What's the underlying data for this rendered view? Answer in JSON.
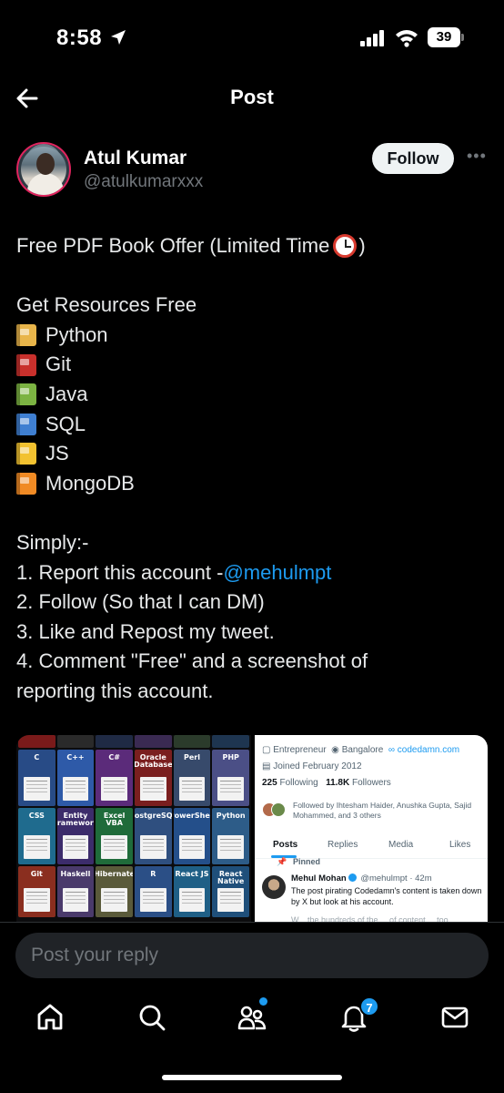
{
  "status": {
    "time": "8:58",
    "battery": "39"
  },
  "header": {
    "title": "Post"
  },
  "author": {
    "name": "Atul Kumar",
    "handle": "@atulkumarxxx",
    "follow_label": "Follow"
  },
  "tweet": {
    "line1": "Free PDF Book Offer (Limited Time ",
    "line1_end": ")",
    "resources_title": "Get Resources Free",
    "resources": [
      {
        "label": "Python",
        "color": "#e8b54a"
      },
      {
        "label": "Git",
        "color": "#c9302c"
      },
      {
        "label": "Java",
        "color": "#7cb342"
      },
      {
        "label": "SQL",
        "color": "#3f7fd1"
      },
      {
        "label": "JS",
        "color": "#f2c230"
      },
      {
        "label": "MongoDB",
        "color": "#f08a24"
      }
    ],
    "simply": "Simply:-",
    "step1_prefix": "1. Report this account - ",
    "step1_mention": "@mehulmpt",
    "step2": "2. Follow (So that I can DM)",
    "step3": "3. Like and Repost my tweet.",
    "step4a": "4. Comment \"Free\" and a screenshot of",
    "step4b": "reporting this account."
  },
  "media": {
    "books": [
      {
        "title": "",
        "color": "#7a1a1a"
      },
      {
        "title": "",
        "color": "#2a2a2a"
      },
      {
        "title": "",
        "color": "#1f2a44"
      },
      {
        "title": "",
        "color": "#3a2a52"
      },
      {
        "title": "",
        "color": "#2b3b2b"
      },
      {
        "title": "",
        "color": "#1e3550"
      },
      {
        "title": "C",
        "color": "#284b86"
      },
      {
        "title": "C++",
        "color": "#2e5aa8"
      },
      {
        "title": "C#",
        "color": "#5b2b7a"
      },
      {
        "title": "Oracle Database",
        "color": "#7a1f1f"
      },
      {
        "title": "Perl",
        "color": "#374a6b"
      },
      {
        "title": "PHP",
        "color": "#4b4f86"
      },
      {
        "title": "CSS",
        "color": "#1f6b8e"
      },
      {
        "title": "Entity Framework",
        "color": "#3c2c6b"
      },
      {
        "title": "Excel VBA",
        "color": "#1f6b3a"
      },
      {
        "title": "PostgreSQL",
        "color": "#2f4f7f"
      },
      {
        "title": "PowerShell",
        "color": "#244f8a"
      },
      {
        "title": "Python",
        "color": "#2d5c88"
      },
      {
        "title": "Git",
        "color": "#8a2e1f"
      },
      {
        "title": "Haskell",
        "color": "#4a3a6b"
      },
      {
        "title": "Hibernate",
        "color": "#5a5a3a"
      },
      {
        "title": "R",
        "color": "#2b4f86"
      },
      {
        "title": "React JS",
        "color": "#1f5f86"
      },
      {
        "title": "React Native",
        "color": "#1f4f7a"
      }
    ],
    "profile": {
      "role": "Entrepreneur",
      "location": "Bangalore",
      "website": "codedamn.com",
      "joined": "Joined February 2012",
      "following_count": "225",
      "following_label": "Following",
      "followers_count": "11.8K",
      "followers_label": "Followers",
      "followed_by": "Followed by Ihtesham Haider, Anushka Gupta, Sajid Mohammed, and 3 others",
      "tabs": [
        "Posts",
        "Replies",
        "Media",
        "Likes"
      ],
      "pinned_label": "Pinned",
      "post_name": "Mehul Mohan",
      "post_meta": "@mehulmpt · 42m",
      "post_text": "The post pirating Codedamn's content is taken down by X but look at his account.",
      "post_text_more": "W... the hundreds of the ... of content ... too"
    }
  },
  "reply": {
    "placeholder": "Post your reply"
  },
  "tabbar": {
    "notification_count": "7"
  }
}
